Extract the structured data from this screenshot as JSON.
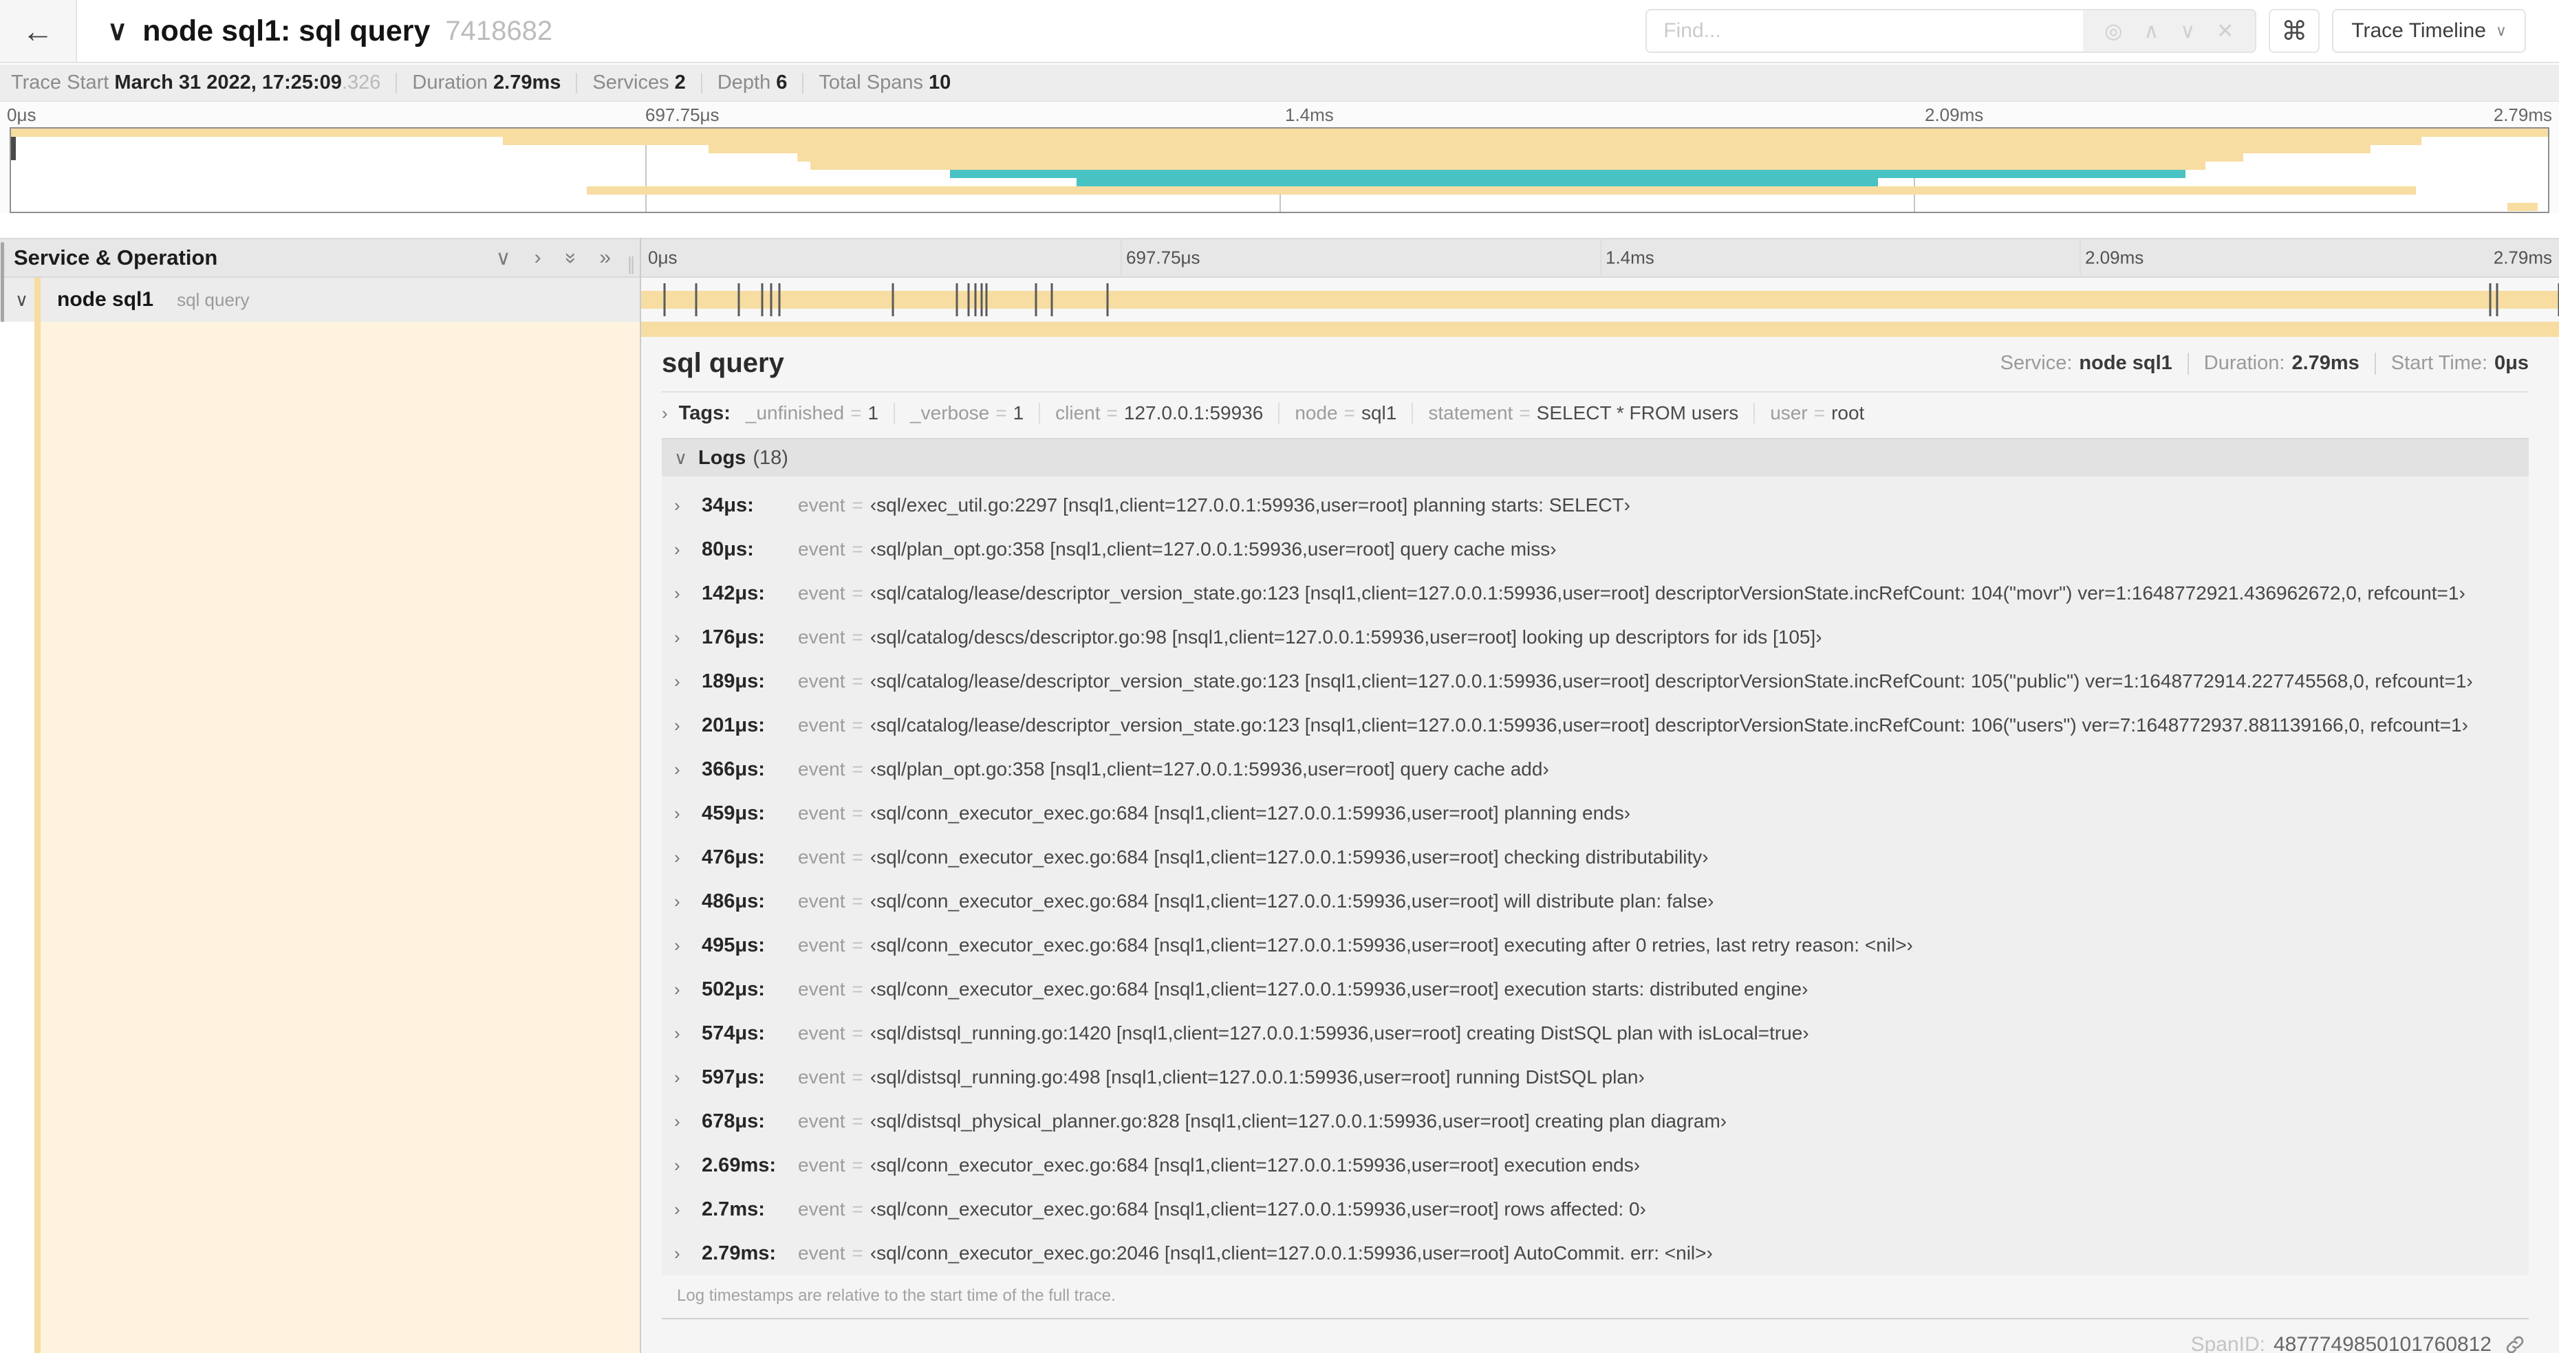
{
  "colors": {
    "tan": "#f7dda1",
    "teal": "#49c2c4",
    "tick": "#5a5a5a"
  },
  "header": {
    "back_icon": "←",
    "title_chevron": "∨",
    "title": "node sql1: sql query",
    "trace_id": "7418682",
    "find": {
      "placeholder": "Find...",
      "controls": [
        {
          "name": "locate-icon",
          "glyph": "◎"
        },
        {
          "name": "prev-result-icon",
          "glyph": "∧"
        },
        {
          "name": "next-result-icon",
          "glyph": "∨"
        },
        {
          "name": "clear-search-icon",
          "glyph": "✕"
        }
      ]
    },
    "shortcut_button": "⌘",
    "view_button": {
      "label": "Trace Timeline",
      "chevron": "∨"
    }
  },
  "trace_meta": {
    "items": [
      {
        "label": "Trace Start",
        "value": "March 31 2022, 17:25:09",
        "suffix": ".326"
      },
      {
        "label": "Duration",
        "value": "2.79ms"
      },
      {
        "label": "Services",
        "value": "2"
      },
      {
        "label": "Depth",
        "value": "6"
      },
      {
        "label": "Total Spans",
        "value": "10"
      }
    ]
  },
  "timeline": {
    "total_us": 2790,
    "ticks": [
      {
        "label": "0μs",
        "pos": 0
      },
      {
        "label": "697.75μs",
        "pos": 25
      },
      {
        "label": "1.4ms",
        "pos": 50
      },
      {
        "label": "2.09ms",
        "pos": 75
      },
      {
        "label": "2.79ms",
        "pos": 100
      }
    ],
    "gridlines": [
      25,
      50,
      75
    ]
  },
  "minimap": {
    "rows": 10,
    "bars": [
      {
        "row": 0,
        "start": 0,
        "end": 100,
        "color": "tan"
      },
      {
        "row": 1,
        "start": 19.4,
        "end": 95,
        "color": "tan"
      },
      {
        "row": 2,
        "start": 27.5,
        "end": 93,
        "color": "tan"
      },
      {
        "row": 3,
        "start": 31,
        "end": 88,
        "color": "tan"
      },
      {
        "row": 4,
        "start": 31.5,
        "end": 86.5,
        "color": "tan"
      },
      {
        "row": 5,
        "start": 37,
        "end": 85.7,
        "color": "teal"
      },
      {
        "row": 6,
        "start": 42,
        "end": 73.6,
        "color": "teal"
      },
      {
        "row": 7,
        "start": 22.7,
        "end": 94.8,
        "color": "tan"
      },
      {
        "row": 9,
        "start": 98.4,
        "end": 99.6,
        "color": "tan"
      }
    ]
  },
  "left_panel": {
    "title": "Service & Operation",
    "icons": [
      {
        "name": "collapse-one-icon",
        "glyph": "∨",
        "rotate": false
      },
      {
        "name": "expand-one-icon",
        "glyph": "›",
        "rotate": false
      },
      {
        "name": "collapse-all-icon",
        "glyph": "»",
        "rotate": true
      },
      {
        "name": "expand-all-icon",
        "glyph": "»",
        "rotate": false
      },
      {
        "name": "column-resize-handle",
        "glyph": "∥",
        "rotate": false
      }
    ],
    "span": {
      "chevron": "∨",
      "service": "node sql1",
      "operation": "sql query"
    }
  },
  "detail": {
    "title": "sql query",
    "meta": [
      {
        "label": "Service:",
        "value": "node sql1"
      },
      {
        "label": "Duration:",
        "value": "2.79ms"
      },
      {
        "label": "Start Time:",
        "value": "0μs"
      }
    ],
    "tags": {
      "chevron": "›",
      "label": "Tags:",
      "items": [
        {
          "key": "_unfinished",
          "value": "1"
        },
        {
          "key": "_verbose",
          "value": "1"
        },
        {
          "key": "client",
          "value": "127.0.0.1:59936"
        },
        {
          "key": "node",
          "value": "sql1"
        },
        {
          "key": "statement",
          "value": "SELECT * FROM users"
        },
        {
          "key": "user",
          "value": "root"
        }
      ]
    },
    "logs": {
      "chevron": "∨",
      "title": "Logs",
      "count_display": "(18)",
      "row_chevron": "›",
      "field": "event",
      "entries": [
        {
          "time": "34μs:",
          "t_us": 34,
          "value": "‹sql/exec_util.go:2297 [nsql1,client=127.0.0.1:59936,user=root] planning starts: SELECT›"
        },
        {
          "time": "80μs:",
          "t_us": 80,
          "value": "‹sql/plan_opt.go:358 [nsql1,client=127.0.0.1:59936,user=root] query cache miss›"
        },
        {
          "time": "142μs:",
          "t_us": 142,
          "value": "‹sql/catalog/lease/descriptor_version_state.go:123 [nsql1,client=127.0.0.1:59936,user=root] descriptorVersionState.incRefCount: 104(\"movr\") ver=1:1648772921.436962672,0, refcount=1›"
        },
        {
          "time": "176μs:",
          "t_us": 176,
          "value": "‹sql/catalog/descs/descriptor.go:98 [nsql1,client=127.0.0.1:59936,user=root] looking up descriptors for ids [105]›"
        },
        {
          "time": "189μs:",
          "t_us": 189,
          "value": "‹sql/catalog/lease/descriptor_version_state.go:123 [nsql1,client=127.0.0.1:59936,user=root] descriptorVersionState.incRefCount: 105(\"public\") ver=1:1648772914.227745568,0, refcount=1›"
        },
        {
          "time": "201μs:",
          "t_us": 201,
          "value": "‹sql/catalog/lease/descriptor_version_state.go:123 [nsql1,client=127.0.0.1:59936,user=root] descriptorVersionState.incRefCount: 106(\"users\") ver=7:1648772937.881139166,0, refcount=1›"
        },
        {
          "time": "366μs:",
          "t_us": 366,
          "value": "‹sql/plan_opt.go:358 [nsql1,client=127.0.0.1:59936,user=root] query cache add›"
        },
        {
          "time": "459μs:",
          "t_us": 459,
          "value": "‹sql/conn_executor_exec.go:684 [nsql1,client=127.0.0.1:59936,user=root] planning ends›"
        },
        {
          "time": "476μs:",
          "t_us": 476,
          "value": "‹sql/conn_executor_exec.go:684 [nsql1,client=127.0.0.1:59936,user=root] checking distributability›"
        },
        {
          "time": "486μs:",
          "t_us": 486,
          "value": "‹sql/conn_executor_exec.go:684 [nsql1,client=127.0.0.1:59936,user=root] will distribute plan: false›"
        },
        {
          "time": "495μs:",
          "t_us": 495,
          "value": "‹sql/conn_executor_exec.go:684 [nsql1,client=127.0.0.1:59936,user=root] executing after 0 retries, last retry reason: <nil>›"
        },
        {
          "time": "502μs:",
          "t_us": 502,
          "value": "‹sql/conn_executor_exec.go:684 [nsql1,client=127.0.0.1:59936,user=root] execution starts: distributed engine›"
        },
        {
          "time": "574μs:",
          "t_us": 574,
          "value": "‹sql/distsql_running.go:1420 [nsql1,client=127.0.0.1:59936,user=root] creating DistSQL plan with isLocal=true›"
        },
        {
          "time": "597μs:",
          "t_us": 597,
          "value": "‹sql/distsql_running.go:498 [nsql1,client=127.0.0.1:59936,user=root] running DistSQL plan›"
        },
        {
          "time": "678μs:",
          "t_us": 678,
          "value": "‹sql/distsql_physical_planner.go:828 [nsql1,client=127.0.0.1:59936,user=root] creating plan diagram›"
        },
        {
          "time": "2.69ms:",
          "t_us": 2690,
          "value": "‹sql/conn_executor_exec.go:684 [nsql1,client=127.0.0.1:59936,user=root] execution ends›"
        },
        {
          "time": "2.7ms:",
          "t_us": 2700,
          "value": "‹sql/conn_executor_exec.go:684 [nsql1,client=127.0.0.1:59936,user=root] rows affected: 0›"
        },
        {
          "time": "2.79ms:",
          "t_us": 2790,
          "value": "‹sql/conn_executor_exec.go:2046 [nsql1,client=127.0.0.1:59936,user=root] AutoCommit. err: <nil>›"
        }
      ],
      "footer": "Log timestamps are relative to the start time of the full trace."
    },
    "span_id": {
      "label": "SpanID:",
      "value": "4877749850101760812"
    }
  }
}
